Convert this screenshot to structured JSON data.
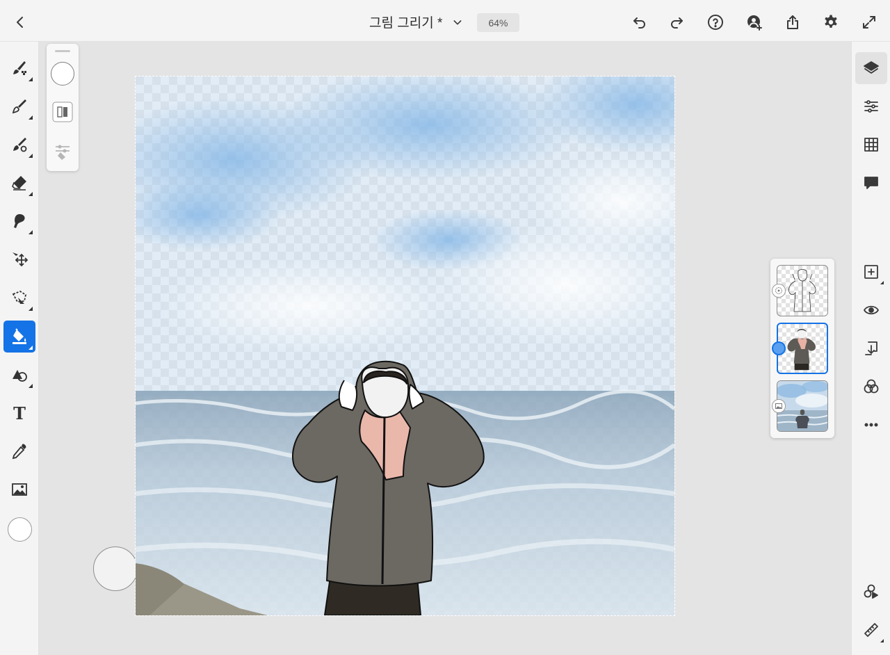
{
  "header": {
    "back_label": "back",
    "document_title": "그림 그리기 *",
    "zoom_level": "64%"
  },
  "header_icons": [
    "chevron-left-icon",
    "chevron-down-icon",
    "undo-icon",
    "redo-icon",
    "help-icon",
    "invite-icon",
    "share-icon",
    "settings-icon",
    "fullscreen-icon"
  ],
  "left_tools": [
    {
      "name": "pixel-brush-icon",
      "active": false
    },
    {
      "name": "live-brush-icon",
      "active": false
    },
    {
      "name": "vector-brush-icon",
      "active": false
    },
    {
      "name": "eraser-icon",
      "active": false
    },
    {
      "name": "smudge-icon",
      "active": false
    },
    {
      "name": "transform-icon",
      "active": false
    },
    {
      "name": "lasso-icon",
      "active": false
    },
    {
      "name": "fill-icon",
      "active": true
    },
    {
      "name": "shapes-icon",
      "active": false
    },
    {
      "name": "text-icon",
      "active": false
    },
    {
      "name": "eyedropper-icon",
      "active": false
    },
    {
      "name": "image-icon",
      "active": false
    }
  ],
  "text_tool_glyph": "T",
  "current_color": "#ffffff",
  "accent_color": "#1473e6",
  "right_tools": [
    "layers-icon",
    "layer-properties-icon",
    "grid-icon",
    "comments-icon",
    "add-layer-icon",
    "visibility-icon",
    "merge-down-icon",
    "blend-mode-icon",
    "more-icon",
    "timelapse-icon",
    "ruler-icon"
  ],
  "layers": [
    {
      "name": "line-art-layer",
      "selected": false,
      "badge": "sketch-layer-icon"
    },
    {
      "name": "color-layer",
      "selected": true,
      "badge": "paint-layer-icon"
    },
    {
      "name": "photo-layer",
      "selected": false,
      "badge": "image-layer-icon"
    }
  ]
}
